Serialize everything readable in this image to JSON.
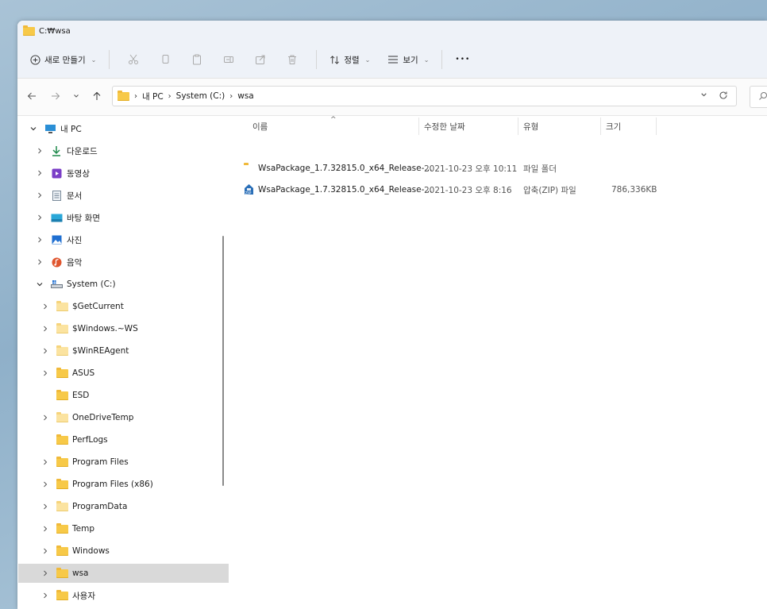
{
  "window": {
    "title": "C:₩wsa"
  },
  "toolbar": {
    "new_label": "새로 만들기",
    "sort_label": "정렬",
    "view_label": "보기",
    "more_label": "•••"
  },
  "address": {
    "crumbs": [
      "내 PC",
      "System (C:)",
      "wsa"
    ]
  },
  "nav": {
    "items": [
      {
        "label": "내 PC"
      },
      {
        "label": "다운로드"
      },
      {
        "label": "동영상"
      },
      {
        "label": "문서"
      },
      {
        "label": "바탕 화면"
      },
      {
        "label": "사진"
      },
      {
        "label": "음악"
      },
      {
        "label": "System (C:)"
      },
      {
        "label": "$GetCurrent"
      },
      {
        "label": "$Windows.~WS"
      },
      {
        "label": "$WinREAgent"
      },
      {
        "label": "ASUS"
      },
      {
        "label": "ESD"
      },
      {
        "label": "OneDriveTemp"
      },
      {
        "label": "PerfLogs"
      },
      {
        "label": "Program Files"
      },
      {
        "label": "Program Files (x86)"
      },
      {
        "label": "ProgramData"
      },
      {
        "label": "Temp"
      },
      {
        "label": "Windows"
      },
      {
        "label": "wsa"
      },
      {
        "label": "사용자"
      }
    ]
  },
  "columns": {
    "name": "이름",
    "date": "수정한 날짜",
    "type": "유형",
    "size": "크기"
  },
  "files": [
    {
      "name": "WsaPackage_1.7.32815.0_x64_Release-...",
      "date": "2021-10-23 오후 10:11",
      "type": "파일 폴더",
      "size": "",
      "icon": "folder-icon"
    },
    {
      "name": "WsaPackage_1.7.32815.0_x64_Release-...",
      "date": "2021-10-23 오후 8:16",
      "type": "압축(ZIP) 파일",
      "size": "786,336KB",
      "icon": "zip-icon"
    }
  ],
  "colors": {
    "folder": "#f7c948",
    "selected": "#d9d9d9",
    "toolbar_bg": "#eef2f8"
  }
}
